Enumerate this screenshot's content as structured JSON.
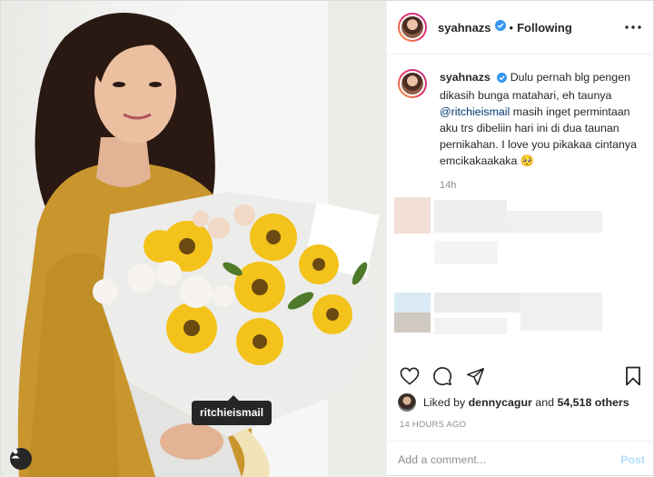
{
  "post": {
    "tagged_user": "ritchieismail"
  },
  "header": {
    "username": "syahnazs",
    "separator": "•",
    "follow_status": "Following"
  },
  "caption": {
    "username": "syahnazs",
    "text_before": "Dulu pernah blg pengen dikasih bunga matahari, eh taunya",
    "mention": "@ritchieismail",
    "text_after": "masih inget permintaan aku trs dibeliin hari ini di dua taunan pernikahan. I love you pikakaa cintanya emcikakaakaka 🥺",
    "time": "14h"
  },
  "likes": {
    "prefix": "Liked by",
    "user": "dennycagur",
    "joiner": "and",
    "others": "54,518 others"
  },
  "posted_ago": "14 HOURS AGO",
  "comment_box": {
    "placeholder": "Add a comment...",
    "post_label": "Post"
  },
  "colors": {
    "verified": "#3897f0",
    "mention": "#00376b",
    "post_button": "#b2dffc",
    "dress": "#c9962e"
  }
}
